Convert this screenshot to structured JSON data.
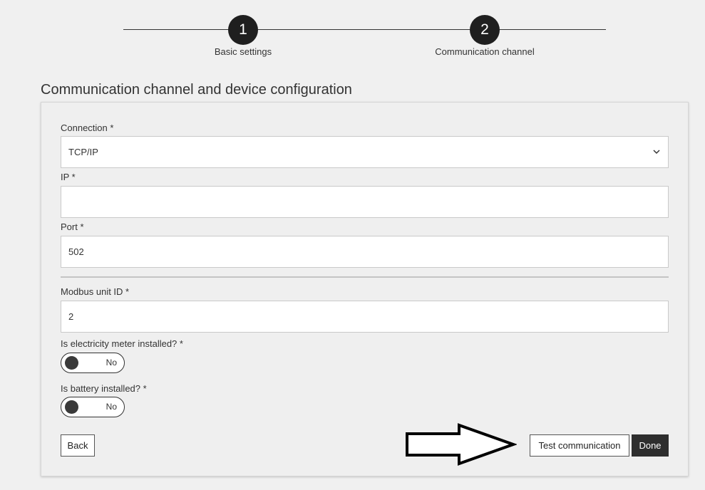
{
  "stepper": {
    "steps": [
      {
        "number": "1",
        "label": "Basic settings"
      },
      {
        "number": "2",
        "label": "Communication channel"
      }
    ]
  },
  "section_title": "Communication channel and device configuration",
  "form": {
    "connection": {
      "label": "Connection *",
      "value": "TCP/IP"
    },
    "ip": {
      "label": "IP *",
      "value": ""
    },
    "port": {
      "label": "Port *",
      "value": "502"
    },
    "modbus_unit_id": {
      "label": "Modbus unit ID *",
      "value": "2"
    },
    "electricity_meter": {
      "label": "Is electricity meter installed? *",
      "state": "No"
    },
    "battery": {
      "label": "Is battery installed? *",
      "state": "No"
    }
  },
  "buttons": {
    "back": "Back",
    "test": "Test communication",
    "done": "Done"
  },
  "icons": {
    "select_chevron": "chevron-down-icon",
    "annotation_arrow": "right-arrow-icon"
  },
  "colors": {
    "step_circle": "#1f1f1f",
    "done_button": "#2e2e2e",
    "page_background": "#f0f0f0"
  }
}
